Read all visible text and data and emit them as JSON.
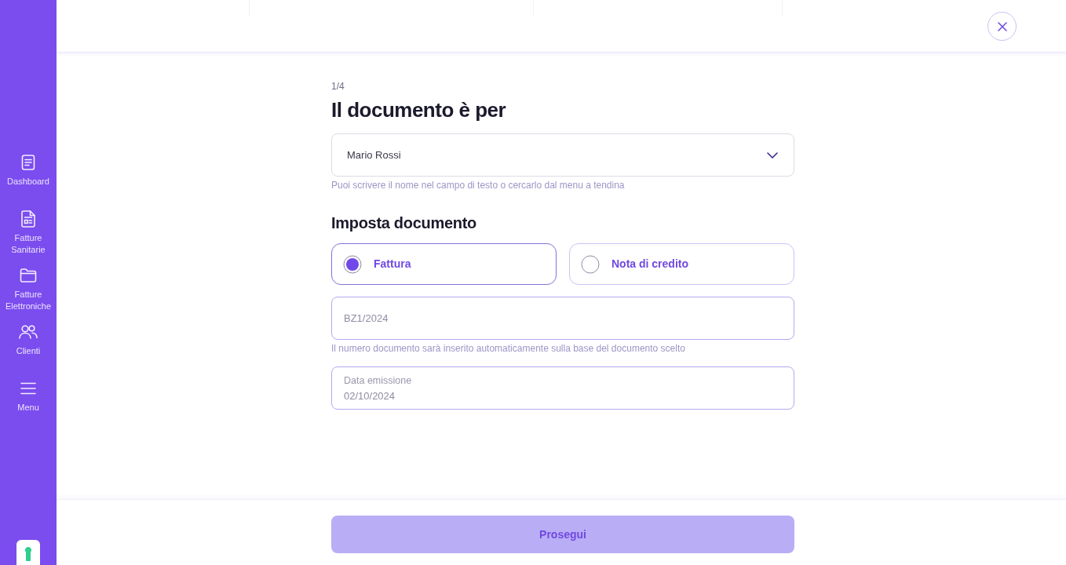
{
  "sidebar": {
    "items": [
      {
        "label": "Dashboard"
      },
      {
        "label": "Fatture Sanitarie"
      },
      {
        "label": "Fatture Elettroniche"
      },
      {
        "label": "Clienti"
      },
      {
        "label": "Menu"
      }
    ]
  },
  "form": {
    "step": "1/4",
    "title": "Il documento è per",
    "recipient": {
      "value": "Mario Rossi",
      "hint": "Puoi scrivere il nome nel campo di testo o cercarlo dal menu a tendina"
    },
    "section_title": "Imposta documento",
    "document_types": [
      {
        "label": "Fattura",
        "selected": true
      },
      {
        "label": "Nota di credito",
        "selected": false
      }
    ],
    "document_number": {
      "value": "BZ1/2024",
      "hint": "Il numero documento sarà inserito automaticamente sulla base del documento scelto"
    },
    "issue_date": {
      "label": "Data emissione",
      "value": "02/10/2024"
    }
  },
  "footer": {
    "button": "Prosegui"
  }
}
